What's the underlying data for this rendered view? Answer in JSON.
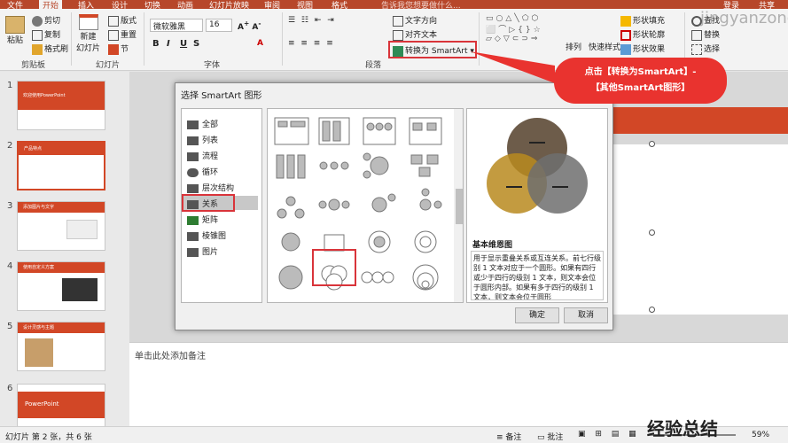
{
  "ribbon_tabs": [
    "文件",
    "开始",
    "插入",
    "设计",
    "切换",
    "动画",
    "幻灯片放映",
    "审阅",
    "视图",
    "开发工具",
    "帮助",
    "格式"
  ],
  "search_hint": "告诉我您想要做什么...",
  "user": {
    "login": "登录",
    "share": "共享"
  },
  "clipboard": {
    "paste": "粘贴",
    "cut": "剪切",
    "copy": "复制",
    "format_painter": "格式刷",
    "label": "剪贴板"
  },
  "slides_group": {
    "new_slide": "新建",
    "new_slide2": "幻灯片",
    "layout": "版式",
    "reset": "重置",
    "section": "节",
    "label": "幻灯片"
  },
  "font_group": {
    "font_name": "微软雅黑",
    "font_size": "16",
    "bold": "B",
    "italic": "I",
    "underline": "U",
    "strike": "S",
    "label": "字体"
  },
  "paragraph_group": {
    "text_direction": "文字方向",
    "align_text": "对齐文本",
    "convert_smartart": "转换为 SmartArt",
    "label": "段落"
  },
  "drawing_group": {
    "arrange": "排列",
    "quick_styles": "快速样式",
    "shape_fill": "形状填充",
    "shape_outline": "形状轮廓",
    "shape_effects": "形状效果"
  },
  "editing_group": {
    "find": "查找",
    "replace": "替换",
    "select": "选择"
  },
  "watermark": "jingyanzonglie",
  "callout": {
    "line1": "点击【转换为SmartArt】-",
    "line2": "【其他SmartArt图形】"
  },
  "slides": [
    {
      "num": "1",
      "title": "欢迎使用PowerPoint"
    },
    {
      "num": "2",
      "title": "产品特点"
    },
    {
      "num": "3",
      "title": "添加图片与文字"
    },
    {
      "num": "4",
      "title": "使用自定义方案"
    },
    {
      "num": "5",
      "title": "设计灵感与主题"
    },
    {
      "num": "6",
      "title": "PowerPoint"
    }
  ],
  "dialog": {
    "title": "选择 SmartArt 图形",
    "categories": [
      "全部",
      "列表",
      "流程",
      "循环",
      "层次结构",
      "关系",
      "矩阵",
      "棱锥图",
      "图片"
    ],
    "selected_category": "关系",
    "preview_name": "基本维恩图",
    "description": "用于显示重叠关系或互连关系。前七行级别 1 文本对应于一个圆形。如果有四行或少于四行的级别 1 文本，则文本会位于圆形内部。如果有多于四行的级别 1 文本，则文本会位于圆形",
    "ok": "确定",
    "cancel": "取消"
  },
  "notes_placeholder": "单击此处添加备注",
  "status": {
    "slide_info": "幻灯片 第 2 张，共 6 张",
    "notes": "备注",
    "comments": "批注",
    "zoom": "59%"
  },
  "colors": {
    "accent": "#b7472a",
    "callout": "#e9332f",
    "venn1": "#5d4a36",
    "venn2": "#b9891e",
    "venn3": "#6e6e6e"
  }
}
